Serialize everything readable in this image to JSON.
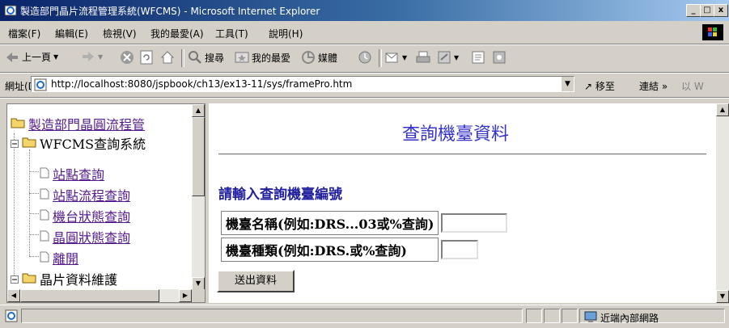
{
  "window": {
    "title": "製造部門晶片流程管理系統(WFCMS) - Microsoft Internet Explorer",
    "controls": {
      "minimize": "_",
      "maximize": "□",
      "close": "x"
    }
  },
  "menu": {
    "items": [
      "檔案(F)",
      "編輯(E)",
      "檢視(V)",
      "我的最愛(A)",
      "工具(T)",
      "說明(H)"
    ]
  },
  "toolbar": {
    "back_label": "上一頁",
    "search_label": "搜尋",
    "favorites_label": "我的最愛",
    "media_label": "媒體"
  },
  "address": {
    "label": "網址(D)",
    "url": "http://localhost:8080/jspbook/ch13/ex13-11/sys/framePro.htm",
    "go_label": "移至",
    "links_label": "連結 »",
    "windows_label": "以 W"
  },
  "tree": {
    "root": "製造部門晶圓流程管",
    "group1": "WFCMS查詢系統",
    "children": [
      "站點查詢",
      "站點流程查詢",
      "機台狀態查詢",
      "晶圓狀態查詢",
      "離開"
    ],
    "group2": "晶片資料維護"
  },
  "main": {
    "title": "查詢機臺資料",
    "subtitle": "請輸入查詢機臺編號",
    "fields": [
      {
        "label": "機臺名稱(例如:DRS...03或%查詢)",
        "value": ""
      },
      {
        "label": "機臺種類(例如:DRS.或%查詢)",
        "value": ""
      }
    ],
    "submit_label": "送出資料"
  },
  "status": {
    "zone_label": "近端內部網路"
  }
}
